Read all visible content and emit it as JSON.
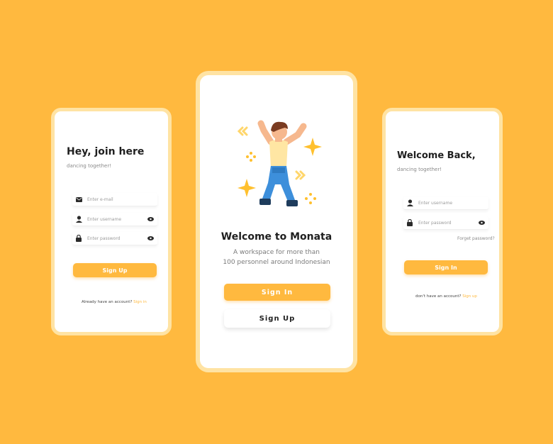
{
  "colors": {
    "background": "#FFB93F",
    "accent": "#FFB93F",
    "frame": "#FFE3A3",
    "text_dark": "#1F1F1F",
    "text_muted": "#8A8A8A"
  },
  "signup_screen": {
    "title": "Hey, join here",
    "subtitle": "dancing together!",
    "email_placeholder": "Enter e-mail",
    "email_icon": "mail-icon",
    "username_placeholder": "Enter username",
    "username_icon": "user-icon",
    "password_placeholder": "Enter password",
    "password_icon": "lock-icon",
    "button_label": "Sign Up",
    "footer_text": "Already have an account?",
    "footer_link": "Sign in"
  },
  "welcome_screen": {
    "title": "Welcome to Monata",
    "description_line1": "A workspace for more than",
    "description_line2": "100 personnel around Indonesian",
    "sign_in_label": "Sign In",
    "sign_up_label": "Sign Up",
    "illustration": "dancing-person-illustration"
  },
  "signin_screen": {
    "title": "Welcome Back,",
    "subtitle": "dancing together!",
    "username_placeholder": "Enter username",
    "password_placeholder": "Enter password",
    "forgot_label": "Forget password?",
    "button_label": "Sign In",
    "footer_text": "don't have an account?",
    "footer_link": "Sign up"
  }
}
